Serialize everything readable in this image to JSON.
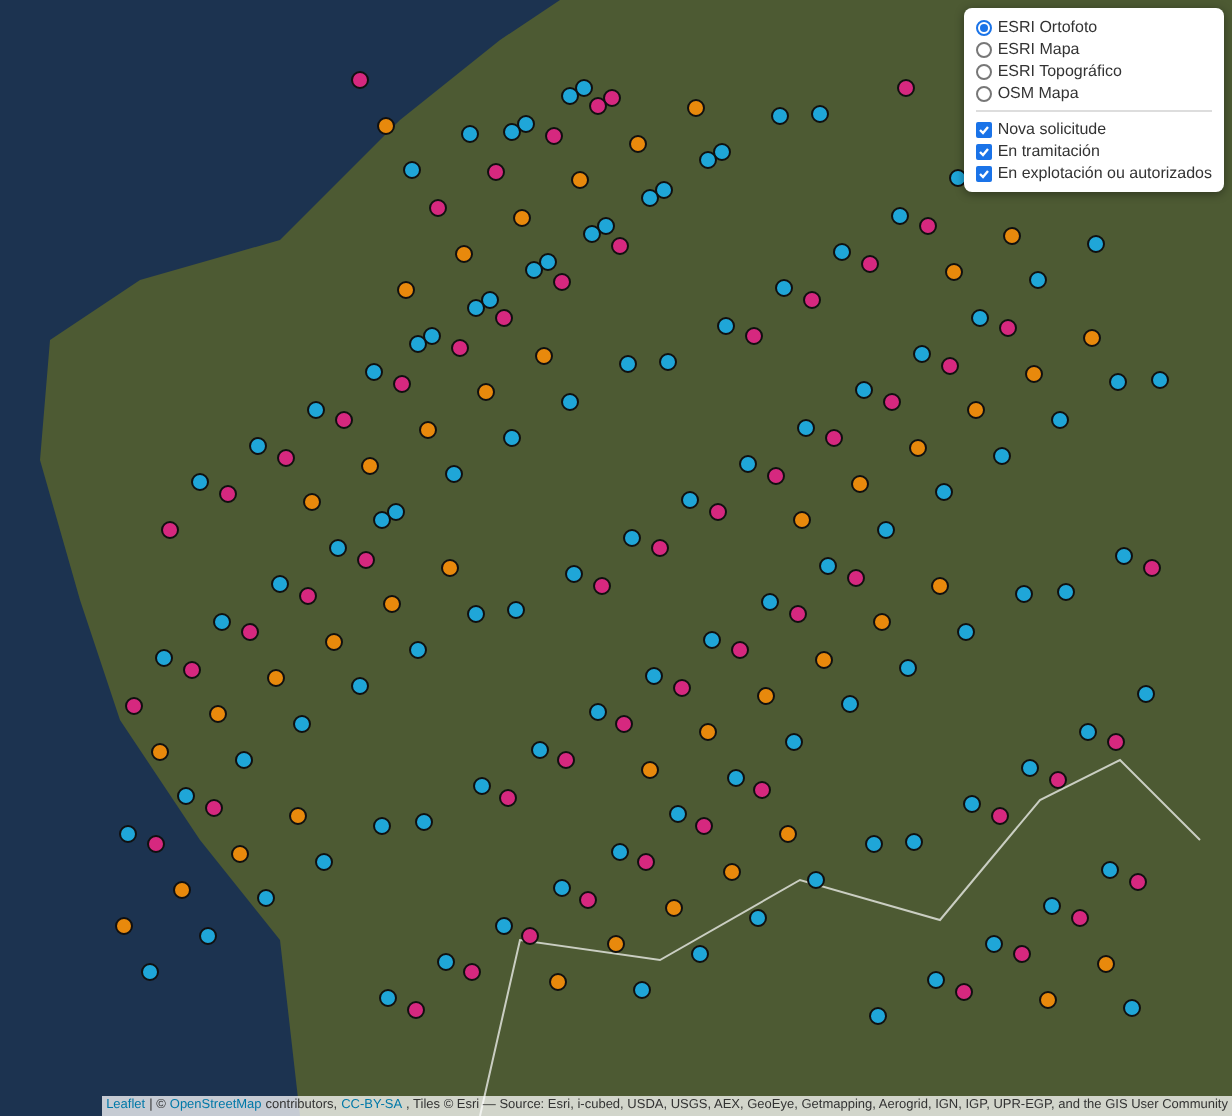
{
  "layer_control": {
    "base_layers": [
      {
        "label": "ESRI Ortofoto",
        "selected": true
      },
      {
        "label": "ESRI Mapa",
        "selected": false
      },
      {
        "label": "ESRI Topográfico",
        "selected": false
      },
      {
        "label": "OSM Mapa",
        "selected": false
      }
    ],
    "overlays": [
      {
        "label": "Nova solicitude",
        "checked": true,
        "color": "#d6287f"
      },
      {
        "label": "En tramitación",
        "checked": true,
        "color": "#e8890c"
      },
      {
        "label": "En explotación ou autorizados",
        "checked": true,
        "color": "#1fa6d8"
      }
    ]
  },
  "attribution": [
    {
      "text": "Leaflet",
      "kind": "link"
    },
    {
      "text": "| ©",
      "kind": "text"
    },
    {
      "text": "OpenStreetMap",
      "kind": "link"
    },
    {
      "text": "contributors,",
      "kind": "text"
    },
    {
      "text": "CC-BY-SA",
      "kind": "link"
    },
    {
      "text": ", Tiles © Esri — Source: Esri, i-cubed, USDA, USGS, AEX, GeoEye, Getmapping, Aerogrid, IGN, IGP, UPR-EGP, and the GIS User Community",
      "kind": "text"
    }
  ]
}
